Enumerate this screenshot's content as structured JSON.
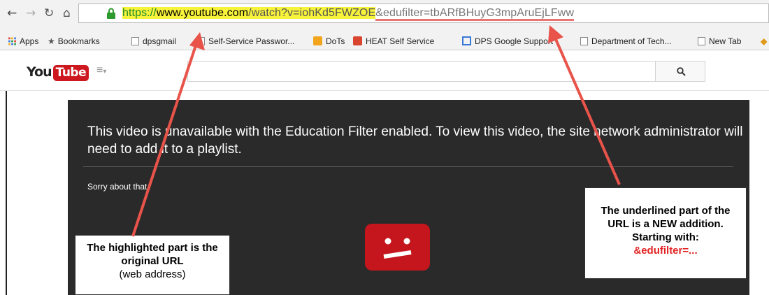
{
  "browser": {
    "url_https": "https://",
    "url_domain": "www.youtube.com",
    "url_path": "/watch?v=iohKd5FWZOE",
    "url_added": "&edufilter=tbARfBHuyG3mpAruEjLFww",
    "bookmarks": [
      {
        "label": "Apps",
        "icon": "apps-grid-icon"
      },
      {
        "label": "Bookmarks",
        "icon": "star-icon"
      },
      {
        "label": "dpsgmail",
        "icon": "page-icon"
      },
      {
        "label": "Self-Service Passwor...",
        "icon": "page-icon"
      },
      {
        "label": "DoTs",
        "icon": "dots-icon"
      },
      {
        "label": "HEAT Self Service",
        "icon": "heat-icon"
      },
      {
        "label": "DPS Google Support",
        "icon": "google-sites-icon"
      },
      {
        "label": "Department of Tech...",
        "icon": "page-icon"
      },
      {
        "label": "New Tab",
        "icon": "page-icon"
      }
    ]
  },
  "youtube": {
    "logo_you": "You",
    "logo_tube": "Tube"
  },
  "player": {
    "message": "This video is unavailable with the Education Filter enabled. To view this video, the site network administrator will need to add it to a playlist.",
    "sorry": "Sorry about that."
  },
  "annotations": {
    "left_bold": "The highlighted part is the original URL",
    "left_normal": "(web address)",
    "right_bold": "The underlined part of the URL is a NEW addition.  Starting with:",
    "right_red": "&edufilter=..."
  },
  "colors": {
    "highlight": "#f7f23a",
    "underline": "#e87474",
    "arrow": "#e8534a",
    "youtube_red": "#cc181e"
  }
}
